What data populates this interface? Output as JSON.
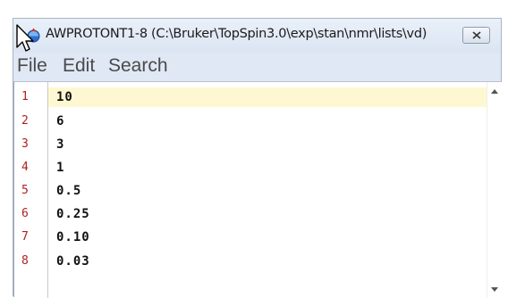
{
  "window": {
    "title": "AWPROTONT1-8 (C:\\Bruker\\TopSpin3.0\\exp\\stan\\nmr\\lists\\vd)",
    "icon": "topspin-app-icon",
    "close_icon": "close-icon"
  },
  "menu": {
    "file": "File",
    "edit": "Edit",
    "search": "Search"
  },
  "editor": {
    "lines": [
      {
        "number": "1",
        "text": "10"
      },
      {
        "number": "2",
        "text": "6"
      },
      {
        "number": "3",
        "text": "3"
      },
      {
        "number": "4",
        "text": "1"
      },
      {
        "number": "5",
        "text": "0.5"
      },
      {
        "number": "6",
        "text": "0.25"
      },
      {
        "number": "7",
        "text": "0.10"
      },
      {
        "number": "8",
        "text": "0.03"
      }
    ],
    "current_line_color": "#fdf8d2",
    "line_number_color": "#b02020"
  },
  "scrollbar": {
    "up_icon": "scroll-up-arrow-icon",
    "down_icon": "scroll-down-arrow-icon"
  }
}
